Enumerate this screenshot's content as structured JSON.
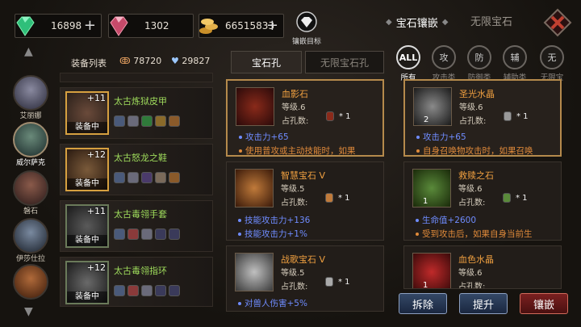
{
  "top": {
    "emerald": {
      "value": "16898",
      "plus": "+"
    },
    "ruby": {
      "value": "1302"
    },
    "gold": {
      "value": "66515833",
      "plus": "+"
    },
    "target_label": "镶嵌目标",
    "tabs": [
      "宝石镶嵌",
      "无限宝石"
    ]
  },
  "avatars": [
    "艾丽娜",
    "威尔萨克",
    "磐石",
    "伊莎仕拉",
    ""
  ],
  "list": {
    "title": "装备列表",
    "attack": "78720",
    "defense": "29827"
  },
  "mid_tabs": [
    "宝石孔",
    "无限宝石孔"
  ],
  "equipment": [
    {
      "name": "太古炼狱皮甲",
      "level": "+11",
      "status": "装备中"
    },
    {
      "name": "太古怒龙之鞋",
      "level": "+12",
      "status": "装备中"
    },
    {
      "name": "太古毒翎手套",
      "level": "+11",
      "status": "装备中"
    },
    {
      "name": "太古毒翎指环",
      "level": "+12",
      "status": "装备中"
    }
  ],
  "filters": [
    {
      "icon": "ALL",
      "label": "所有"
    },
    {
      "icon": "攻",
      "label": "攻击类"
    },
    {
      "icon": "防",
      "label": "防御类"
    },
    {
      "icon": "辅",
      "label": "辅助类"
    },
    {
      "icon": "无",
      "label": "无限宝石"
    }
  ],
  "gems_left": [
    {
      "name": "血影石",
      "level": "等级.6",
      "occ": "占孔数:",
      "occ_val": "* 1",
      "effects": [
        {
          "text": "攻击力+65",
          "color": "blue"
        },
        {
          "text": "使用普攻或主动技能时，如果",
          "color": "orange"
        }
      ]
    },
    {
      "name": "智慧宝石 V",
      "level": "等级.5",
      "occ": "占孔数:",
      "occ_val": "* 1",
      "effects": [
        {
          "text": "技能攻击力+136",
          "color": "blue"
        },
        {
          "text": "技能攻击力+1%",
          "color": "blue"
        }
      ]
    },
    {
      "name": "战歌宝石 V",
      "level": "等级.5",
      "occ": "占孔数:",
      "occ_val": "* 1",
      "effects": [
        {
          "text": "对兽人伤害+5%",
          "color": "blue"
        }
      ]
    }
  ],
  "gems_right": [
    {
      "name": "圣光水晶",
      "level": "等级.6",
      "occ": "占孔数:",
      "occ_val": "* 1",
      "count": "2",
      "effects": [
        {
          "text": "攻击力+65",
          "color": "blue"
        },
        {
          "text": "自身召唤物攻击时，如果召唤",
          "color": "orange"
        }
      ]
    },
    {
      "name": "救赎之石",
      "level": "等级.6",
      "occ": "占孔数:",
      "occ_val": "* 1",
      "count": "1",
      "effects": [
        {
          "text": "生命值+2600",
          "color": "blue"
        },
        {
          "text": "受到攻击后，如果自身当前生",
          "color": "orange"
        }
      ]
    },
    {
      "name": "血色水晶",
      "level": "等级.6",
      "occ": "占孔数:",
      "occ_val": "",
      "count": "1",
      "effects": []
    }
  ],
  "buttons": [
    "拆除",
    "提升",
    "镶嵌"
  ]
}
